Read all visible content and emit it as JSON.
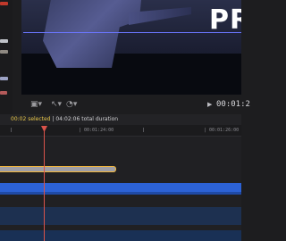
{
  "viewer": {
    "overlay_title": "PR"
  },
  "viewer_controls": {
    "view_menu_icon": "▣▾",
    "tools_menu_icon": "↖▾",
    "speed_menu_icon": "◔▾",
    "play_icon": "▶",
    "timecode": "00:01:2"
  },
  "timeline": {
    "selected": "00:02 selected",
    "total": " | 04:02:06 total duration",
    "ruler": [
      "| 00:01:24:00",
      "| 00:01:26:00"
    ]
  },
  "colors": {
    "selection_accent": "#e7c64a",
    "playhead": "#d9534a",
    "clip_track": "#2c62d6",
    "clip_selected_outline": "#f0b43a"
  },
  "icons": {
    "play": "play-icon",
    "view": "viewer-options-icon",
    "tools": "tool-select-icon",
    "speed": "retime-icon"
  }
}
